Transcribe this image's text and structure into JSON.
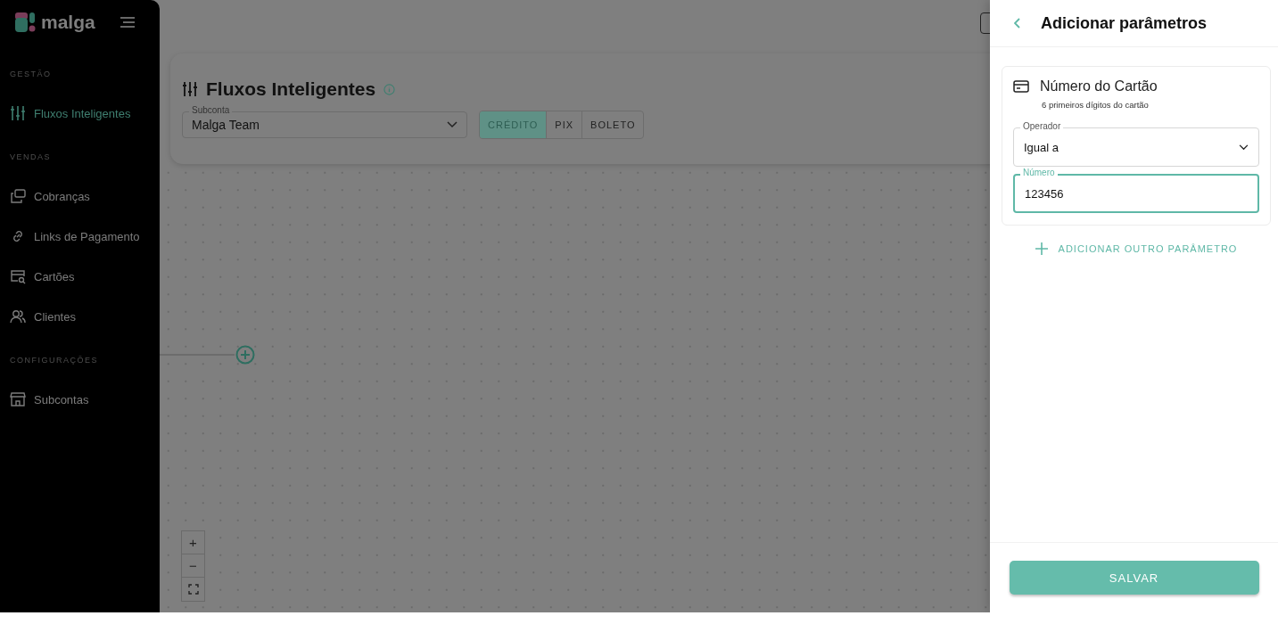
{
  "sidebar": {
    "logo": "malga",
    "sections": [
      {
        "heading": "GESTÃO",
        "items": [
          {
            "label": "Fluxos Inteligentes",
            "kind": "sliders",
            "selected": true
          }
        ]
      },
      {
        "heading": "VENDAS",
        "items": [
          {
            "label": "Cobranças",
            "kind": "charges",
            "selected": false
          },
          {
            "label": "Links de Pagamento",
            "kind": "link",
            "selected": false
          },
          {
            "label": "Cartões",
            "kind": "cards",
            "selected": false
          },
          {
            "label": "Clientes",
            "kind": "clients",
            "selected": false
          }
        ]
      },
      {
        "heading": "CONFIGURAÇÕES",
        "items": [
          {
            "label": "Subcontas",
            "kind": "store",
            "selected": false
          }
        ]
      }
    ]
  },
  "page": {
    "title": "Fluxos Inteligentes",
    "subaccount": {
      "label": "Subconta",
      "value": "Malga Team"
    },
    "payment_tabs": [
      {
        "label": "CRÉDITO",
        "selected": true
      },
      {
        "label": "PIX",
        "selected": false
      },
      {
        "label": "BOLETO",
        "selected": false
      }
    ]
  },
  "zoom_controls": [
    "+",
    "−"
  ],
  "drawer": {
    "title": "Adicionar parâmetros",
    "parameter": {
      "title": "Número do Cartão",
      "description": "6 primeiros dígitos do cartão",
      "operator": {
        "label": "Operador",
        "value": "Igual a"
      },
      "number": {
        "label": "Número",
        "value": "123456",
        "focused": true
      }
    },
    "add_button": "ADICIONAR OUTRO PARÂMETRO",
    "save_button": "SALVAR"
  }
}
